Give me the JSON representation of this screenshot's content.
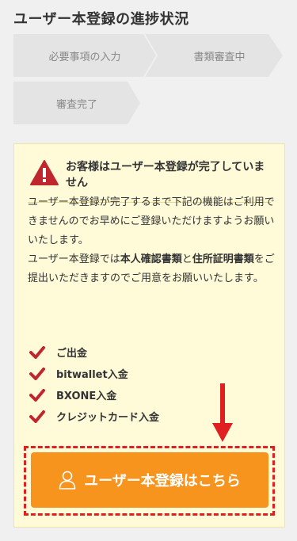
{
  "page": {
    "title": "ユーザー本登録の進捗状況"
  },
  "steps": [
    {
      "label": "必要事項の入力"
    },
    {
      "label": "書類審査中"
    },
    {
      "label": "審査完了"
    }
  ],
  "notice": {
    "title": "お客様はユーザー本登録が完了していません",
    "paragraph1": "ユーザー本登録が完了するまで下記の機能はご利用できませんのでお早めにご登録いただけますようお願いいたします。",
    "paragraph2_pre": "ユーザー本登録では",
    "paragraph2_bold1": "本人確認書類",
    "paragraph2_mid": "と",
    "paragraph2_bold2": "住所証明書類",
    "paragraph2_post": "をご提出いただきますのでご用意をお願いいたします。",
    "features": [
      {
        "label": "ご出金"
      },
      {
        "label": "bitwallet入金"
      },
      {
        "label": "BXONE入金"
      },
      {
        "label": "クレジットカード入金"
      }
    ]
  },
  "cta": {
    "label": "ユーザー本登録はこちら"
  },
  "colors": {
    "accent": "#f7941d",
    "warning": "#c0262d",
    "highlight": "#e02020",
    "notice_bg": "#fffbd9"
  }
}
